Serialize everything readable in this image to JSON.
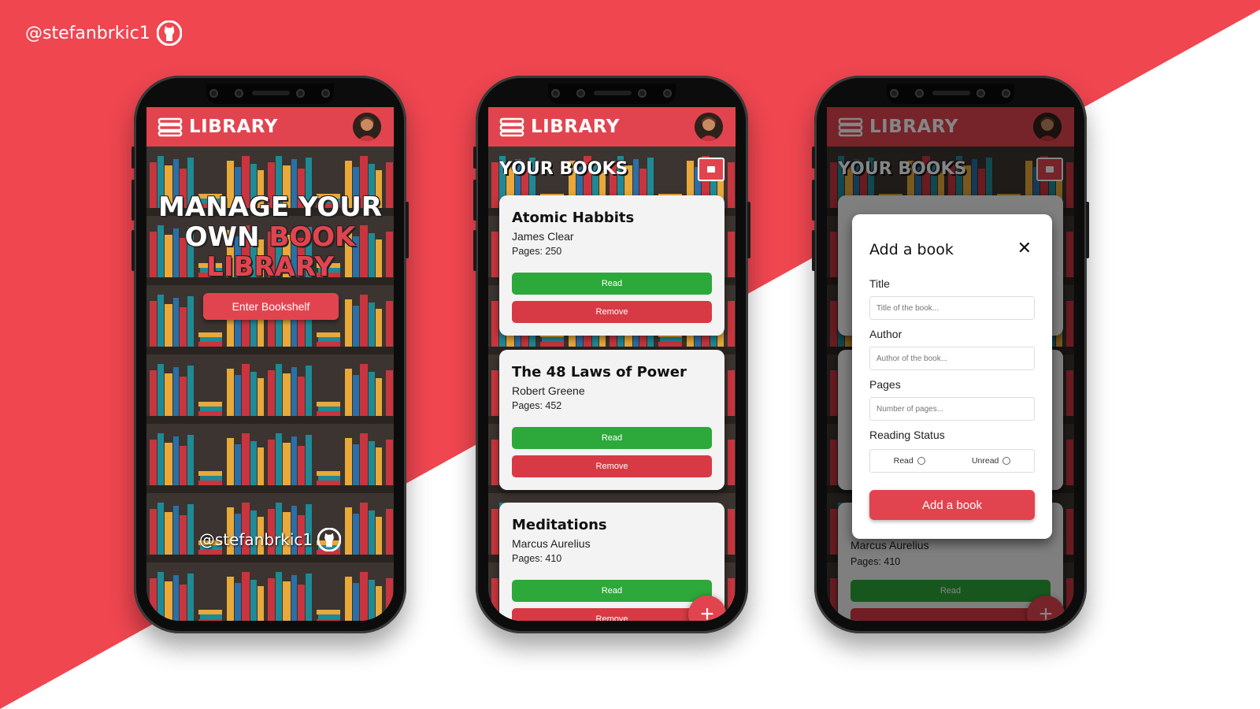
{
  "handle": "@stefanbrkic1",
  "icons": {
    "brand": "github-icon",
    "logo": "books-stack-icon",
    "add": "plus-icon",
    "close": "close-icon",
    "bookshelf": "book-icon"
  },
  "colors": {
    "accent": "#e2444f",
    "read": "#2da83a",
    "remove": "#d73a44",
    "shelf": "#3b3430"
  },
  "phone1": {
    "logo_text": "LIBRARY",
    "hero_line1": "MANAGE YOUR",
    "hero_line2a": "OWN",
    "hero_line2b": "BOOK",
    "hero_line3": "LIBRARY",
    "enter_button": "Enter Bookshelf",
    "handle": "@stefanbrkic1"
  },
  "phone2": {
    "logo_text": "LIBRARY",
    "section_title": "YOUR BOOKS",
    "books": [
      {
        "title": "Atomic Habbits",
        "author": "James Clear",
        "pages": "Pages: 250",
        "read_label": "Read",
        "remove_label": "Remove"
      },
      {
        "title": "The 48 Laws of Power",
        "author": "Robert Greene",
        "pages": "Pages: 452",
        "read_label": "Read",
        "remove_label": "Remove"
      },
      {
        "title": "Meditations",
        "author": "Marcus Aurelius",
        "pages": "Pages: 410",
        "read_label": "Read",
        "remove_label": "Remove"
      }
    ],
    "fab": "+"
  },
  "phone3": {
    "logo_text": "LIBRARY",
    "section_title": "YOUR BOOKS",
    "bg_author": "Marcus Aurelius",
    "bg_pages": "Pages: 410",
    "bg_read": "Read",
    "fab": "+",
    "modal": {
      "title": "Add a book",
      "close": "✕",
      "title_label": "Title",
      "title_placeholder": "Title of the book...",
      "author_label": "Author",
      "author_placeholder": "Author of the book...",
      "pages_label": "Pages",
      "pages_placeholder": "Number of pages...",
      "status_label": "Reading Status",
      "status_read": "Read",
      "status_unread": "Unread",
      "submit": "Add a book"
    }
  }
}
